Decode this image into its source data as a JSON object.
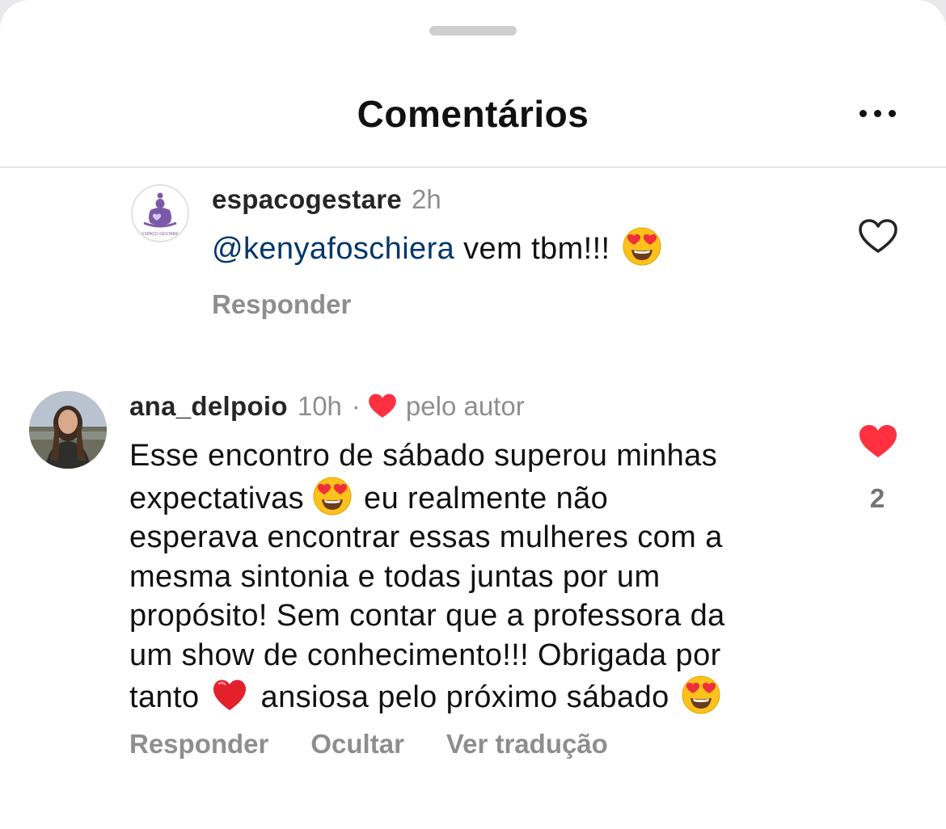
{
  "header": {
    "title": "Comentários"
  },
  "comments": [
    {
      "username": "espacogestare",
      "time": "2h",
      "mention": "@kenyafoschiera",
      "text": " vem tbm!!!",
      "reply_label": "Responder",
      "avatar_caption": "ESPAÇO GESTARE"
    },
    {
      "username": "ana_delpoio",
      "time": "10h",
      "separator": "·",
      "author_label": "pelo autor",
      "lines": {
        "l1": "Esse encontro de sábado superou minhas",
        "l2a": "expectativas",
        "l2b": "eu realmente não",
        "l3": "esperava encontrar essas mulheres com a",
        "l4": "mesma sintonia e todas juntas por um",
        "l5": "propósito! Sem contar que a professora da",
        "l6": "um show de conhecimento!!! Obrigada por",
        "l7a": "tanto",
        "l7b": "ansiosa pelo próximo sábado"
      },
      "like_count": "2",
      "actions": {
        "reply": "Responder",
        "hide": "Ocultar",
        "translate": "Ver tradução"
      }
    }
  ],
  "colors": {
    "mention": "#00376b",
    "like_red": "#ff3040",
    "muted": "#8e8e8e"
  }
}
